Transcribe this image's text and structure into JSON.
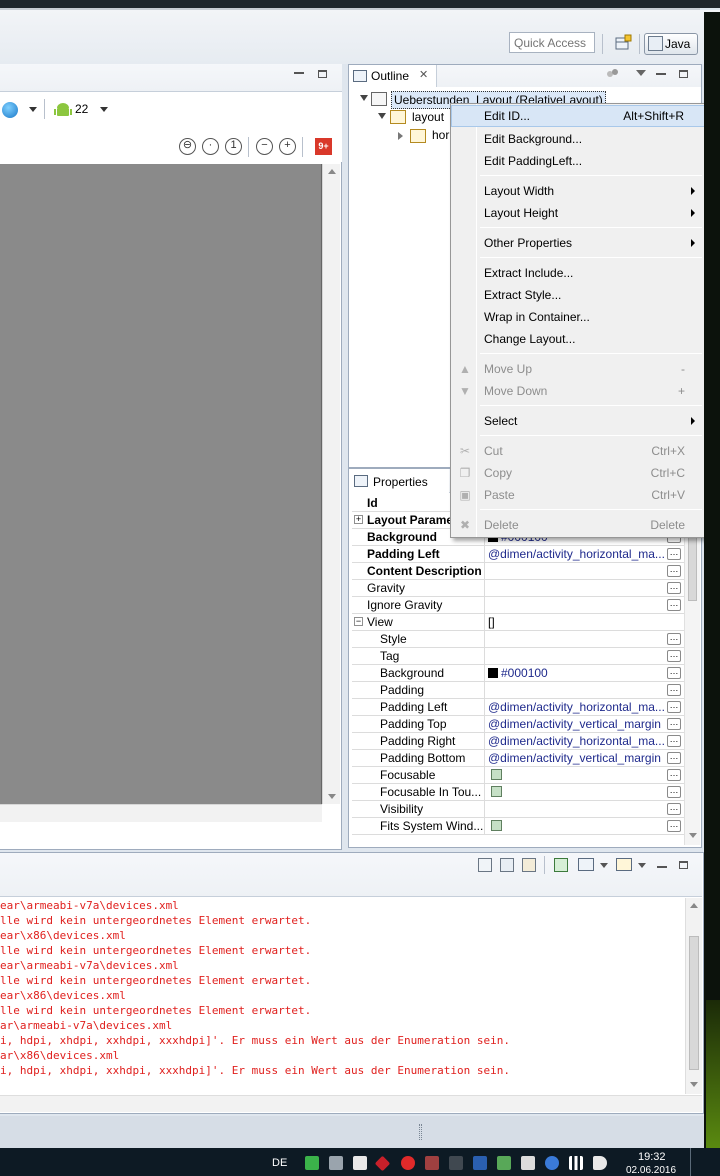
{
  "toolbar": {
    "quick_access_placeholder": "Quick Access",
    "perspective_label": "Java",
    "api_level": "22"
  },
  "outline": {
    "tab_label": "Outline",
    "tree": {
      "root": "Ueberstunden_Layout (RelativeLayout)",
      "child": "layout",
      "grandchild": "hor"
    }
  },
  "context_menu": {
    "items": [
      {
        "label": "Edit ID...",
        "accel": "Alt+Shift+R",
        "state": "highlighted"
      },
      {
        "label": "Edit Background..."
      },
      {
        "label": "Edit PaddingLeft..."
      },
      {
        "label": "Layout Width",
        "submenu": true
      },
      {
        "label": "Layout Height",
        "submenu": true
      },
      {
        "label": "Other Properties",
        "submenu": true
      },
      {
        "label": "Extract Include..."
      },
      {
        "label": "Extract Style..."
      },
      {
        "label": "Wrap in Container..."
      },
      {
        "label": "Change Layout..."
      },
      {
        "label": "Move Up",
        "accel": "-",
        "state": "disabled",
        "icon": "move-up-icon"
      },
      {
        "label": "Move Down",
        "accel": "+",
        "state": "disabled",
        "icon": "move-down-icon"
      },
      {
        "label": "Select",
        "submenu": true
      },
      {
        "label": "Cut",
        "accel": "Ctrl+X",
        "state": "disabled",
        "icon": "cut-icon"
      },
      {
        "label": "Copy",
        "accel": "Ctrl+C",
        "state": "disabled",
        "icon": "copy-icon"
      },
      {
        "label": "Paste",
        "accel": "Ctrl+V",
        "state": "disabled",
        "icon": "paste-icon"
      },
      {
        "label": "Delete",
        "accel": "Delete",
        "state": "disabled",
        "icon": "delete-icon"
      }
    ]
  },
  "properties": {
    "tab_label": "Properties",
    "rows": [
      {
        "name": "Id",
        "value": "",
        "bold": true
      },
      {
        "name": "Layout Parame",
        "value": "",
        "bold": true,
        "expander": "+"
      },
      {
        "name": "Background",
        "value": "#000100",
        "bold": true,
        "swatch": true
      },
      {
        "name": "Padding Left",
        "value": "@dimen/activity_horizontal_ma...",
        "bold": true
      },
      {
        "name": "Content Description",
        "value": "",
        "bold": true
      },
      {
        "name": "Gravity",
        "value": ""
      },
      {
        "name": "Ignore Gravity",
        "value": ""
      },
      {
        "name": "View",
        "value": "[]",
        "expander": "−"
      },
      {
        "name": "Style",
        "value": "",
        "sub": true
      },
      {
        "name": "Tag",
        "value": "",
        "sub": true
      },
      {
        "name": "Background",
        "value": "#000100",
        "sub": true,
        "swatch": true
      },
      {
        "name": "Padding",
        "value": "",
        "sub": true
      },
      {
        "name": "Padding Left",
        "value": "@dimen/activity_horizontal_ma...",
        "sub": true
      },
      {
        "name": "Padding Top",
        "value": "@dimen/activity_vertical_margin",
        "sub": true
      },
      {
        "name": "Padding Right",
        "value": "@dimen/activity_horizontal_ma...",
        "sub": true
      },
      {
        "name": "Padding Bottom",
        "value": "@dimen/activity_vertical_margin",
        "sub": true
      },
      {
        "name": "Focusable",
        "value": "",
        "sub": true,
        "checkbox": true
      },
      {
        "name": "Focusable In Tou...",
        "value": "",
        "sub": true,
        "checkbox": true
      },
      {
        "name": "Visibility",
        "value": "",
        "sub": true
      },
      {
        "name": "Fits System Wind...",
        "value": "",
        "sub": true,
        "checkbox": true
      }
    ]
  },
  "console": {
    "lines": [
      "ear\\armeabi-v7a\\devices.xml",
      "lle wird kein untergeordnetes Element erwartet.",
      "ear\\x86\\devices.xml",
      "lle wird kein untergeordnetes Element erwartet.",
      "ear\\armeabi-v7a\\devices.xml",
      "lle wird kein untergeordnetes Element erwartet.",
      "ear\\x86\\devices.xml",
      "lle wird kein untergeordnetes Element erwartet.",
      "ar\\armeabi-v7a\\devices.xml",
      "i, hdpi, xhdpi, xxhdpi, xxxhdpi]'. Er muss ein Wert aus der Enumeration sein.",
      "ar\\x86\\devices.xml",
      "i, hdpi, xhdpi, xxhdpi, xxxhdpi]'. Er muss ein Wert aus der Enumeration sein."
    ]
  },
  "taskbar": {
    "language": "DE",
    "time": "19:32",
    "date": "02.06.2016"
  },
  "colors": {
    "console_error": "#e0201e",
    "highlight": "#d8e6f6",
    "property_value": "#1f2a8c"
  }
}
